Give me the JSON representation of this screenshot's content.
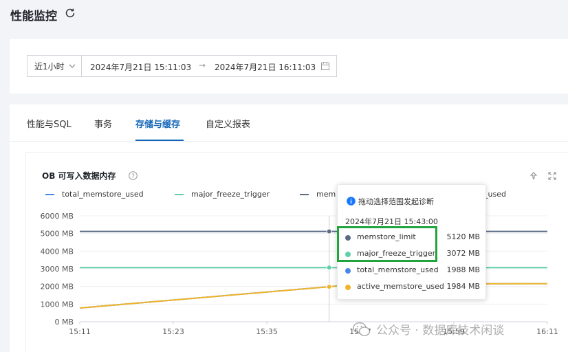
{
  "header": {
    "title": "性能监控",
    "refresh_icon": "refresh-icon"
  },
  "filter": {
    "range_label": "近1小时",
    "start": "2024年7月21日 15:11:03",
    "arrow": "→",
    "end": "2024年7月21日 16:11:03",
    "calendar_icon": "calendar-icon"
  },
  "tabs": [
    {
      "label": "性能与SQL",
      "active": false
    },
    {
      "label": "事务",
      "active": false
    },
    {
      "label": "存储与缓存",
      "active": true
    },
    {
      "label": "自定义报表",
      "active": false
    }
  ],
  "panel": {
    "title": "OB 可写入数据内存",
    "legend": [
      {
        "name": "total_memstore_used",
        "color": "#4a86e8"
      },
      {
        "name": "major_freeze_trigger",
        "color": "#5fd0a8"
      },
      {
        "name": "memstore_limit",
        "color": "#5b6b86"
      },
      {
        "name": "active_memstore_used",
        "color": "#f0b429"
      }
    ],
    "legend_partial_texts": [
      "mem",
      "memstore_used"
    ]
  },
  "tooltip": {
    "hint": "拖动选择范围发起诊断",
    "time": "2024年7月21日 15:43:00",
    "rows": [
      {
        "name": "memstore_limit",
        "value": "5120 MB",
        "color": "#5b6b86"
      },
      {
        "name": "major_freeze_trigger",
        "value": "3072 MB",
        "color": "#5fd0a8"
      },
      {
        "name": "total_memstore_used",
        "value": "1988 MB",
        "color": "#4a86e8"
      },
      {
        "name": "active_memstore_used",
        "value": "1984 MB",
        "color": "#f0b429"
      }
    ]
  },
  "watermark": "公众号 · 数据库技术闲谈",
  "chart_data": {
    "type": "line",
    "y_ticks": [
      "6000 MB",
      "5000 MB",
      "4000 MB",
      "3000 MB",
      "2000 MB",
      "1000 MB",
      "0 MB"
    ],
    "x_ticks": [
      "15:11",
      "15:23",
      "15:35",
      "15:47",
      "15:59",
      "16:11"
    ],
    "ylim": [
      0,
      6000
    ],
    "xlim": [
      "15:11",
      "16:11"
    ],
    "grid": true,
    "legend": "top",
    "series": [
      {
        "name": "memstore_limit",
        "color": "#5b6b86",
        "points": [
          [
            "15:11",
            5120
          ],
          [
            "16:11",
            5120
          ]
        ]
      },
      {
        "name": "major_freeze_trigger",
        "color": "#5fd0a8",
        "points": [
          [
            "15:11",
            3072
          ],
          [
            "16:11",
            3072
          ]
        ]
      },
      {
        "name": "total_memstore_used",
        "color": "#4a86e8",
        "points": [
          [
            "15:11",
            780
          ],
          [
            "15:43",
            1988
          ],
          [
            "15:47",
            2140
          ],
          [
            "16:11",
            2160
          ]
        ]
      },
      {
        "name": "active_memstore_used",
        "color": "#f0b429",
        "points": [
          [
            "15:11",
            780
          ],
          [
            "15:43",
            1984
          ],
          [
            "15:47",
            2140
          ],
          [
            "16:11",
            2160
          ]
        ]
      }
    ],
    "hover_x": "15:43"
  }
}
